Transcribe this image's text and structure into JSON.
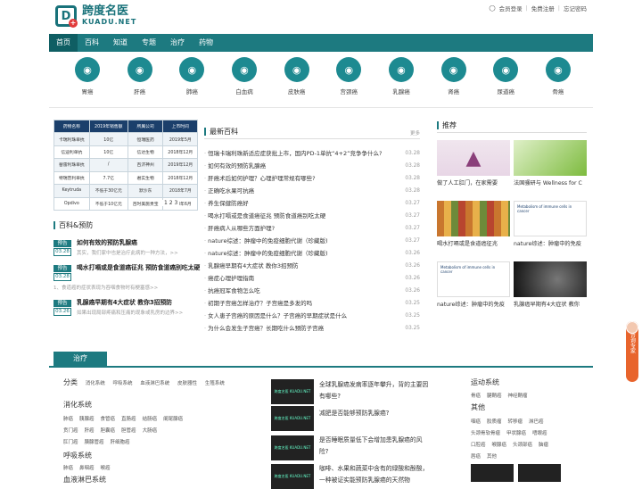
{
  "site": {
    "logo_cn": "跨度名医",
    "logo_en": "KUADU.NET",
    "logo_mark": "D"
  },
  "top_links": [
    "会员登录",
    "免费注册",
    "忘记密码"
  ],
  "nav": [
    "首页",
    "百科",
    "知道",
    "专题",
    "治疗",
    "药物"
  ],
  "categories": [
    "胃癌",
    "肝癌",
    "肺癌",
    "白血病",
    "皮肤癌",
    "宫颈癌",
    "乳腺癌",
    "肾癌",
    "尿道癌",
    "骨癌"
  ],
  "table": {
    "rows": [
      [
        "药物名称",
        "2019年销售额",
        "所属公司",
        "上市时间"
      ],
      [
        "卡瑞利珠单抗",
        "10亿",
        "恒瑞医药",
        "2019年5月"
      ],
      [
        "信迪利单抗",
        "10亿",
        "信达生物",
        "2018年12月"
      ],
      [
        "替雷利珠单抗",
        "/",
        "百济神州",
        "2019年12月"
      ],
      [
        "特瑞普利单抗",
        "7.7亿",
        "君实生物",
        "2018年12月"
      ],
      [
        "Keytruda",
        "不低于30亿元",
        "默沙东",
        "2018年7月"
      ],
      [
        "Opdivo",
        "不低于10亿元",
        "百时美施贵宝",
        "2018年6月"
      ]
    ],
    "pager": "1 2 3"
  },
  "left_section": {
    "title": "百科&预防",
    "items": [
      {
        "badge": "预告",
        "date": "03.28",
        "title": "如何有效的预防乳腺癌",
        "desc": "其实，我们家中也是治疗此病的一种方法，>>"
      },
      {
        "badge": "预告",
        "date": "03.28",
        "title": "喝水打嗝或是食道癌征兆 预防食道癌别吃太硬",
        "desc": "1、食道癌的症状表现为吞咽食物时有梗塞感>>"
      },
      {
        "badge": "预告",
        "date": "03.26",
        "title": "乳腺癌早期有4大症状 教你3招预防",
        "desc": "如果出现局部疼痛和压痛的现象或乳房的边界>>"
      }
    ]
  },
  "middle": {
    "title": "最新百科",
    "more": "更多",
    "items": [
      {
        "t": "恒瑞卡瑞利珠新适应症获批上市，国内PD-1单抗“4+2”竞争争什么?",
        "d": "03.28"
      },
      {
        "t": "如何有效的预防乳腺癌",
        "d": "03.28"
      },
      {
        "t": "肝癌术后如何护理？心理护理常规有哪些?",
        "d": "03.28"
      },
      {
        "t": "正确吃水果可抗癌",
        "d": "03.28"
      },
      {
        "t": "养生保健防癌好",
        "d": "03.27"
      },
      {
        "t": "喝水打嗝或是食道癌征兆 预防食道癌别吃太硬",
        "d": "03.27"
      },
      {
        "t": "肝癌病人从哪些方面护理?",
        "d": "03.27"
      },
      {
        "t": "nature综述：肿瘤中的免疫细胞代谢（珍藏版)",
        "d": "03.27"
      },
      {
        "t": "nature综述：肿瘤中的免疫细胞代谢（珍藏版)",
        "d": "03.26"
      },
      {
        "t": "乳腺癌早期有4大症状 教你3招预防",
        "d": "03.26"
      },
      {
        "t": "癌症心理护理指南",
        "d": "03.26"
      },
      {
        "t": "抗癌冠军食物怎么吃",
        "d": "03.26"
      },
      {
        "t": "初期子宫癌怎样治疗？子宫癌是多发的吗",
        "d": "03.25"
      },
      {
        "t": "女人患子宫癌的原因是什么？子宫癌的早期症状是什么",
        "d": "03.25"
      },
      {
        "t": "为什么会发生子宫癌？长期吃什么预防子宫癌",
        "d": "03.25"
      }
    ]
  },
  "recommend": {
    "title": "推荐",
    "items": [
      "做了人工肛门，在家需要",
      "法国骚研与 Wellness for C",
      "喝水打嗝或是食道癌征兆",
      "nature综述：肿瘤中的免疫",
      "nature综述：肿瘤中的免疫",
      "乳腺癌早期有4大症状 教你"
    ],
    "img_text": "Metabolism of immune cells in cancer"
  },
  "float_tab": "咨询专家",
  "bottom": {
    "tab": "治疗",
    "left": {
      "fenlei_label": "分类",
      "fenlei": [
        "消化系统",
        "呼吸系统",
        "血液淋巴系统",
        "皮肤器性",
        "生殖系统"
      ],
      "groups": [
        {
          "h": "消化系统",
          "items": [
            "肺癌",
            "胰腺癌",
            "食管癌",
            "直肠癌",
            "结肠癌",
            "阑尾腺癌",
            "贲门癌",
            "肝癌",
            "胆囊癌",
            "胆管癌",
            "大肠癌",
            "肛门癌",
            "胰腺管癌",
            "肝细胞癌"
          ]
        },
        {
          "h": "呼吸系统",
          "items": [
            "肺癌",
            "鼻咽癌",
            "喉癌"
          ]
        },
        {
          "h": "血液淋巴系统",
          "items": []
        }
      ]
    },
    "mid": [
      {
        "img": "跨度名医 KUADU.NET",
        "t": "全球乳腺癌发病率逐年攀升，背的主要因有哪些?"
      },
      {
        "img": "跨度名医 KUADU.NET",
        "t": "减肥是否能够预防乳腺癌?"
      },
      {
        "img": "跨度名医 KUADU.NET",
        "t": "是否睡眠质量低下会增加患乳腺癌的风险?"
      },
      {
        "img": "跨度名医 KUADU.NET",
        "t": "咖啡、水果和蔬菜中含有的绿酸和酚酸，一种被证实能预防乳腺癌的天然物"
      }
    ],
    "right": [
      {
        "h": "运动系统",
        "items": [
          "骨癌",
          "腱鞘癌",
          "神经鞘瘤"
        ]
      },
      {
        "h": "其他",
        "items": [
          "咽癌",
          "胶质瘤",
          "转移瘤",
          "淋巴癌",
          "头颈骨软骨瘤",
          "甲状腺癌",
          "嗜眼癌",
          "口腔癌",
          "喉腺癌",
          "头颈部癌",
          "脑瘤",
          "唇癌",
          "其他"
        ]
      }
    ]
  }
}
